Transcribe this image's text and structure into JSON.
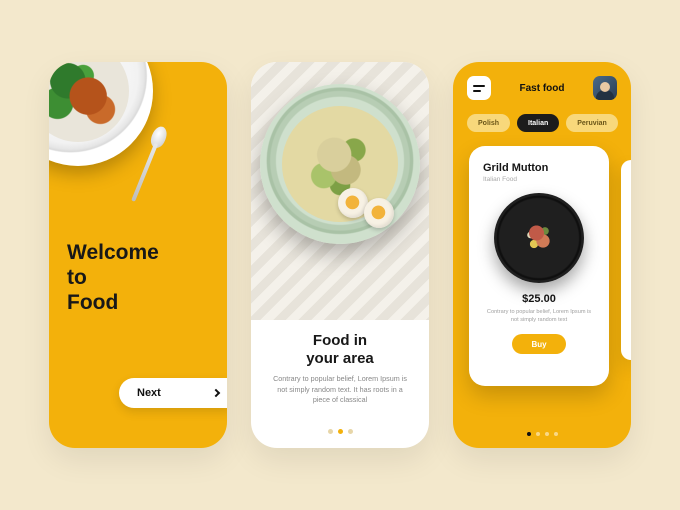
{
  "colors": {
    "accent": "#f3b10b",
    "canvas": "#f3e8cc",
    "dark": "#181818"
  },
  "screen1": {
    "title_line1": "Welcome",
    "title_line2": "to",
    "title_line3": "Food",
    "next_label": "Next"
  },
  "screen2": {
    "headline_line1": "Food in",
    "headline_line2": "your area",
    "description": "Contrary to popular belief, Lorem Ipsum is not simply random text. It has roots in a piece of classical",
    "page_index": 1,
    "page_count": 3
  },
  "screen3": {
    "header_title": "Fast food",
    "tabs": [
      {
        "label": "Polish",
        "active": false
      },
      {
        "label": "Italian",
        "active": true
      },
      {
        "label": "Peruvian",
        "active": false
      }
    ],
    "card": {
      "title": "Grild Mutton",
      "subtitle": "Italian Food",
      "price": "$25.00",
      "description": "Contrary to popular belief, Lorem Ipsum is not simply random text",
      "buy_label": "Buy"
    },
    "page_index": 0,
    "page_count": 4
  }
}
